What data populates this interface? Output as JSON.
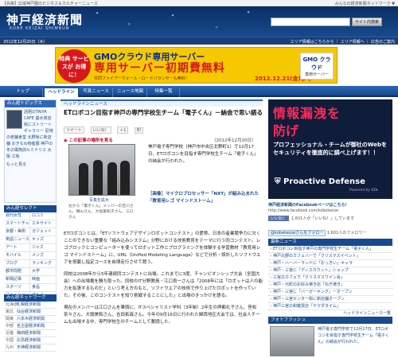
{
  "top_strip": {
    "tag": "【兵庫】広域神戸圏のビジネス＆カルチャーニュース",
    "right": "みんなの経済新聞ネットワーク ▼"
  },
  "header": {
    "logo_jp": "神戸経済新聞",
    "logo_en": "KOBE KEIZAI SHIMBUN",
    "search_placeholder": "",
    "search_button": "サイト内検索"
  },
  "datebar": {
    "date": "2012年12月20日（木）",
    "links": "エリア情報はこちらから ｜ エリア情報ヘ ｜ 広告のご案内"
  },
  "banner": {
    "circle": "特典 サービスが お得に！",
    "brand": "GMOクラウド専用サーバー",
    "headline": "専用サーバー初期費無料",
    "sub": "共同ファイアーウォール・ロードバランサーも無料！",
    "date": "2012.12.21(金)まで",
    "logo": "GMO クラウド",
    "logo_sub": "専用サーバー"
  },
  "nav": {
    "tabs": [
      "トップ",
      "ヘッドライン",
      "写真ニュース",
      "ニュース地図",
      "特集一覧"
    ],
    "active": 1
  },
  "topics": {
    "title": "みん経トピックス",
    "items": "話題のTAIYA CAFE 垂水商店街にストリートギャラリー 尼崎の老舗食堂 北野坂に新店舗 おきなわ物産展 神戸の冬の風物詩ルミナリエ 大阪 江坂",
    "more": "もっと見る"
  },
  "select": {
    "title": "みん経セレクト",
    "rows": [
      [
        "週刊女性",
        "ロコミ"
      ],
      [
        "スマートチャンネル",
        "エキサイト"
      ],
      [
        "京都・美術",
        "ガジェット"
      ],
      [
        "英語ニュース",
        "キッズ"
      ],
      [
        "アート",
        "ジャズ"
      ],
      [
        "モバイル",
        "メンズ"
      ],
      [
        "ブログ",
        "ランキング"
      ],
      [
        "都市問題",
        "大学"
      ],
      [
        "新聞記事",
        "映画"
      ],
      [
        "スポーツ",
        "食品"
      ],
      [
        "ファッション",
        "グルメ"
      ]
    ]
  },
  "network": {
    "title": "みん経ネットワーク",
    "rows": [
      [
        "北海道",
        "札幌経済新聞"
      ],
      [
        "東北",
        "仙台経済新聞"
      ],
      [
        "関東",
        "六本木経済新聞"
      ],
      [
        "中部",
        "名古屋経済新聞"
      ],
      [
        "近畿",
        "梅田経済新聞"
      ],
      [
        "中国",
        "広島経済新聞"
      ],
      [
        "九州",
        "天神経済新聞"
      ]
    ]
  },
  "article": {
    "section": "ヘッドラインニュース",
    "title": "ETロボコン目指す神戸の専門学校生チーム「電子くん」－納会で思い語る",
    "share": [
      "ツイート",
      "いいね！",
      "＋1",
      "B!"
    ],
    "map_link": "この記事の場所を見る",
    "pub_date": "（2012年12月20日）",
    "enlarge": "写真を拡大",
    "caption": "左から「電子くん」メンバーの吉川さん、横山さん、大坂美和子さん、三口さん",
    "lead": "神戸電子専門学校（神戸市中央区北野町1）で12月17日、ETロボコンを目指す専門学校生チーム「電子くん」の納会が行われた。",
    "related": "［画像］マイクロプロセッサー「NXT」が組み込まれた「教育用レゴ マインドストーム」",
    "body": [
      "ETロボコンとは、「ETソフトウェアデザインロボットコンテスト」の愛称。日本の産業競争力に欠くことのできない重要な「組み込みシステム」分野における技術教育をテーマに行う同コンテスト。レゴブロックとコンピューターを使ってロボット工作とプログラミングを体験する学習教材「教育用レゴ マインドストーム」に、UML（Unified Modeling Language）などで分析・設計したソフトウエアを搭載し指定コースを自律走行させて競う。",
      "同校は2008年から5年連続同コンテストに出場。これまでに3度、チャンピオンシップ大会（全国大会）への出場権を勝ち取った。同校のIT分野教員・江口良一さんは「2008年には「ロボットは人の能力を拡張するものだ」という考え方のもと、ソフトウエアの技術で作り上げたロボットを作っていた。その後、このコンテストを知り挑戦することにした」と出場のきっかけを語る。",
      "現在のメンバーは江口さんを筆頭に、ITスペシャリスト学科（3年制）2年生の押都礼子さん、笹松奈々さん、大頭美和さん、吉田拓哉さん。今年の9月16日に行われた関西地区大会では、社会人チームも出場する中、専門学校生のチームとして奮闘した。"
    ]
  },
  "ad_right": {
    "h1": "情報漏洩を",
    "h2": "防げ",
    "text": "プロフェッショナル・チームが御社のWebをセキュリティを徹底的に調べ上げます！！",
    "product": "Proactive Defense",
    "product_sub": "Powered by KDL"
  },
  "facebook": {
    "title": "神戸経済新聞のFacebookページはこちら！",
    "url": "http://www.facebook.com/kobekeizai",
    "like": "いいね！",
    "count": "1,601人が「いいね！」しています"
  },
  "twitter": {
    "button": "@kobekeizaiさんをフォロー",
    "count": "1,601人のフォロワー"
  },
  "latest": {
    "title": "最新ニュース",
    "items": [
      "ETロボコン目指す神戸の専門学校生チーム「電子くん」",
      "神戸北野のカフェバーで「クリスマスイベント」",
      "神戸・ハーバーランドに「おっきい」キャラ",
      "神戸・三宮に「ディスカウント」ショップ",
      "三宮のカフェで「クリスマスワイン会」",
      "神戸・元町のお好み焼き店「ねぎ焼き」",
      "神戸・三宮に「バーガーキング」ーオープン",
      "神戸・三宮センター街に新店舗オープン",
      "神戸三宮の和雑貨店「ヤマダタイム」"
    ],
    "more": "ヘッドラインニュース一覧"
  },
  "flash": {
    "title": "フォトフラッシュ",
    "text": "神戸電子専門学校で12月17日、ETロボコンを目指す専門学校生チーム「電子くん」の納会が行われた。"
  },
  "colors": {
    "brand_dark": "#0b2f63",
    "brand": "#174a8e",
    "accent_red": "#d8181f",
    "banner_yellow": "#f6c800"
  }
}
